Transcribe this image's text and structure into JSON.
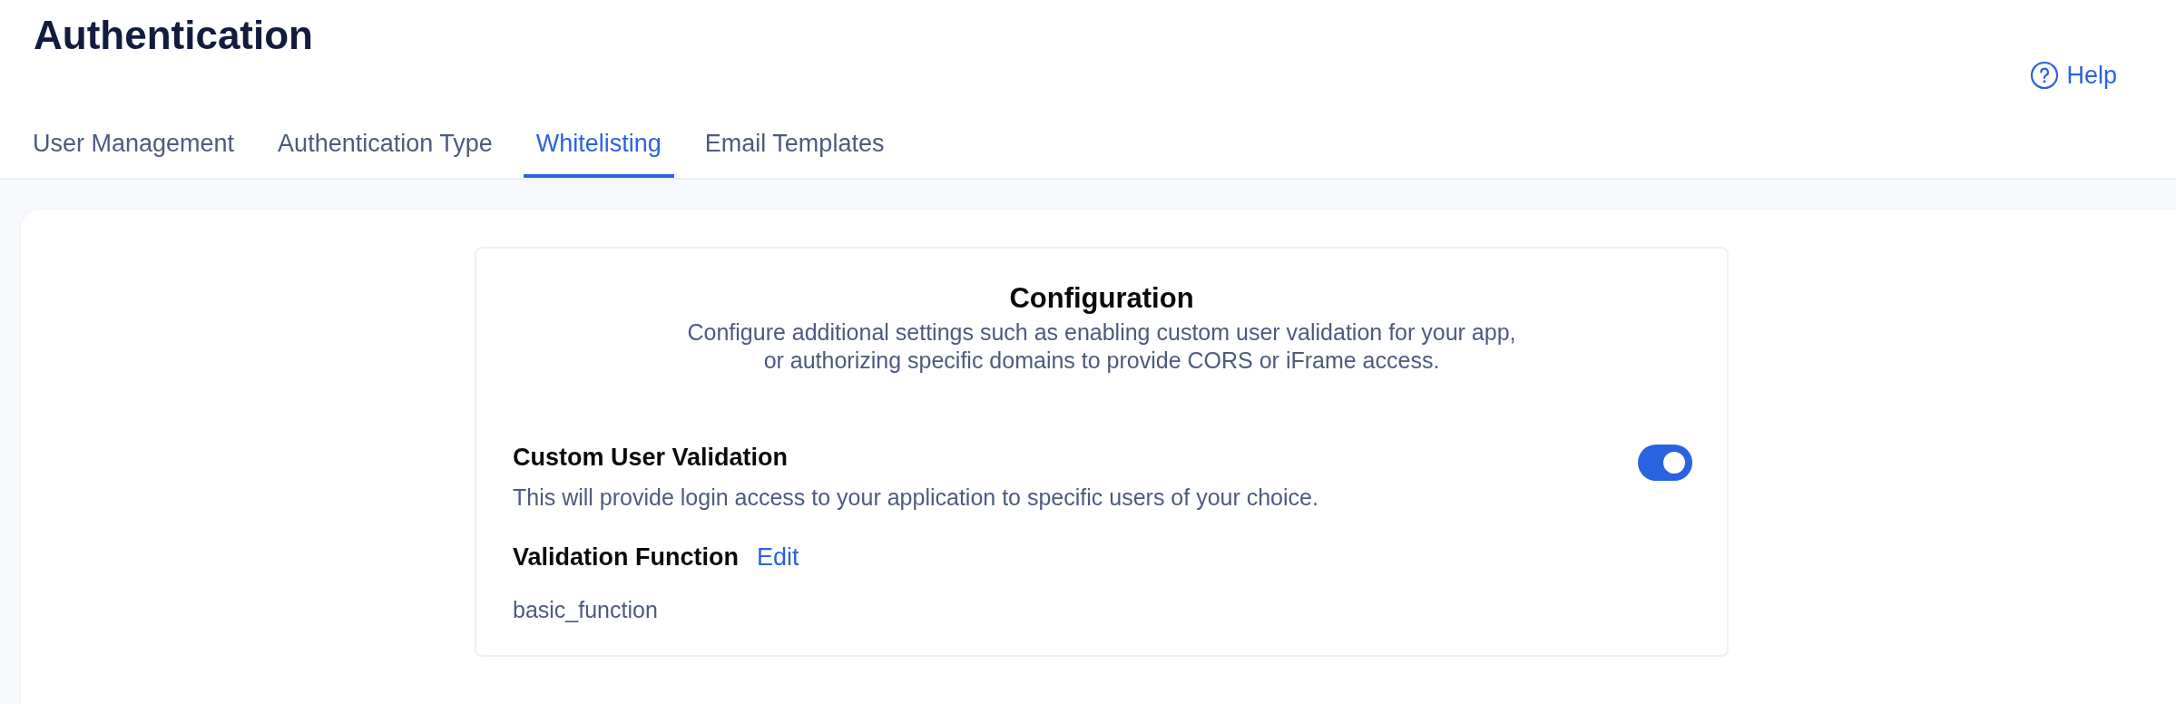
{
  "page": {
    "title": "Authentication",
    "help": "Help"
  },
  "tabs": [
    {
      "label": "User Management",
      "selected": false
    },
    {
      "label": "Authentication Type",
      "selected": false
    },
    {
      "label": "Whitelisting",
      "selected": true
    },
    {
      "label": "Email Templates",
      "selected": false
    }
  ],
  "configuration": {
    "title": "Configuration",
    "description": "Configure additional settings such as enabling custom user validation for your app,\nor authorizing specific domains to provide CORS or iFrame access.",
    "setting": {
      "title": "Custom User Validation",
      "description": "This will provide login access to your application to specific users of your choice.",
      "on": true
    },
    "function": {
      "label": "Validation Function",
      "action": "Edit",
      "value": "basic_function"
    }
  }
}
